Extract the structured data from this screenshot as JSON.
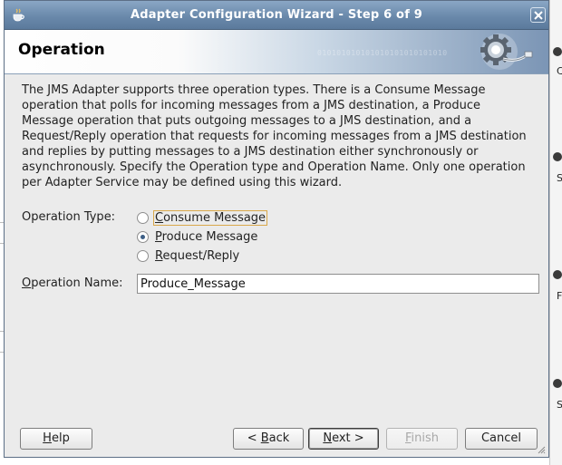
{
  "window": {
    "title": "Adapter Configuration Wizard - Step 6 of 9"
  },
  "page": {
    "title": "Operation",
    "header_decoration": "010101010101010101010101010",
    "description": "The JMS Adapter supports three operation types.  There is a Consume Message operation that polls for incoming messages from a JMS destination, a Produce Message operation that puts outgoing messages to a JMS destination, and a Request/Reply operation that requests for incoming messages from a JMS destination and replies by putting messages to a JMS destination either synchronously or asynchronously.  Specify the Operation type and Operation Name.  Only one operation per Adapter Service may be defined using this wizard."
  },
  "operation_type": {
    "label": "Operation Type:",
    "options": [
      {
        "label": "Consume Message",
        "selected": false,
        "focused": true
      },
      {
        "label": "Produce Message",
        "selected": true,
        "focused": false
      },
      {
        "label": "Request/Reply",
        "selected": false,
        "focused": false
      }
    ]
  },
  "operation_name": {
    "label": "Operation Name:",
    "value": "Produce_Message"
  },
  "buttons": {
    "help": "Help",
    "back": "< Back",
    "next": "Next >",
    "finish": "Finish",
    "cancel": "Cancel"
  },
  "background": {
    "right_fragments": [
      "C",
      "S",
      "F",
      "S"
    ]
  },
  "colors": {
    "titlebar": "#6a89ab",
    "dialog_bg": "#ebebeb",
    "radio_dot": "#3d5f86",
    "focus_border": "#d9a84a"
  }
}
